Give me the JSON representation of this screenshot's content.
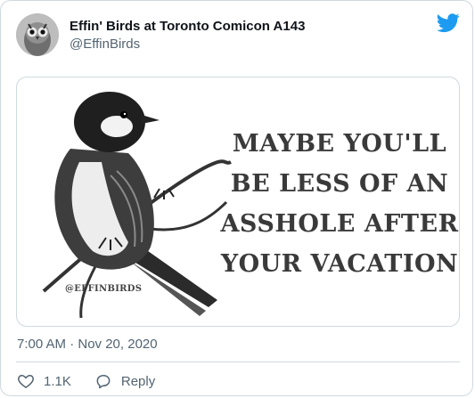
{
  "tweet": {
    "author": {
      "display_name": "Effin' Birds at Toronto Comicon A143",
      "handle": "@EffinBirds",
      "avatar_icon": "owl-avatar-icon"
    },
    "platform_icon": "twitter-bird-icon",
    "media": {
      "quote_lines": [
        "MAYBE YOU'LL",
        "BE LESS OF AN",
        "ASSHOLE AFTER",
        "YOUR VACATION"
      ],
      "watermark": "@EFFINBIRDS"
    },
    "timestamp": "7:00 AM · Nov 20, 2020",
    "actions": {
      "like_count": "1.1K",
      "reply_label": "Reply"
    }
  },
  "colors": {
    "brand_blue": "#1d9bf0",
    "secondary_text": "#536471",
    "border": "#cfd9de"
  }
}
